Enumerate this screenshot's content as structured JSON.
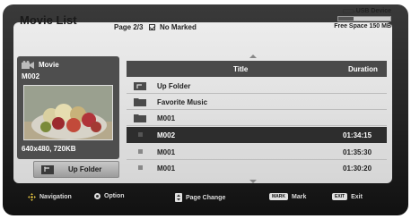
{
  "screen": {
    "title": "Movie List",
    "page_info": "Page 2/3",
    "marked_label": "No Marked"
  },
  "usb": {
    "device_label": "USB Device",
    "free_space": "Free Space 150 MB",
    "usage_fraction": 0.3
  },
  "preview": {
    "type_label": "Movie",
    "name": "M002",
    "resolution_size": "640x480, 720KB",
    "up_folder_button": "Up Folder"
  },
  "table": {
    "columns": [
      "Title",
      "Duration"
    ],
    "rows": [
      {
        "icon": "up-folder-icon",
        "title": "Up Folder",
        "duration": "",
        "selected": false
      },
      {
        "icon": "folder-icon",
        "title": "Favorite Music",
        "duration": "",
        "selected": false
      },
      {
        "icon": "folder-icon",
        "title": "M001",
        "duration": "",
        "selected": false
      },
      {
        "icon": "movie-file-icon",
        "title": "M002",
        "duration": "01:34:15",
        "selected": true
      },
      {
        "icon": "movie-file-icon",
        "title": "M001",
        "duration": "01:35:30",
        "selected": false
      },
      {
        "icon": "movie-file-icon",
        "title": "M001",
        "duration": "01:30:20",
        "selected": false
      }
    ]
  },
  "footer": {
    "navigation": "Navigation",
    "option": "Option",
    "page_change": "Page Change",
    "mark_key": "MARK",
    "mark": "Mark",
    "exit_key": "EXIT",
    "exit": "Exit"
  },
  "colors": {
    "frame": "#1a1a1a",
    "panel": "#e2e2e2",
    "header": "#4a4a4a",
    "selected_row": "#2d2d2d"
  }
}
